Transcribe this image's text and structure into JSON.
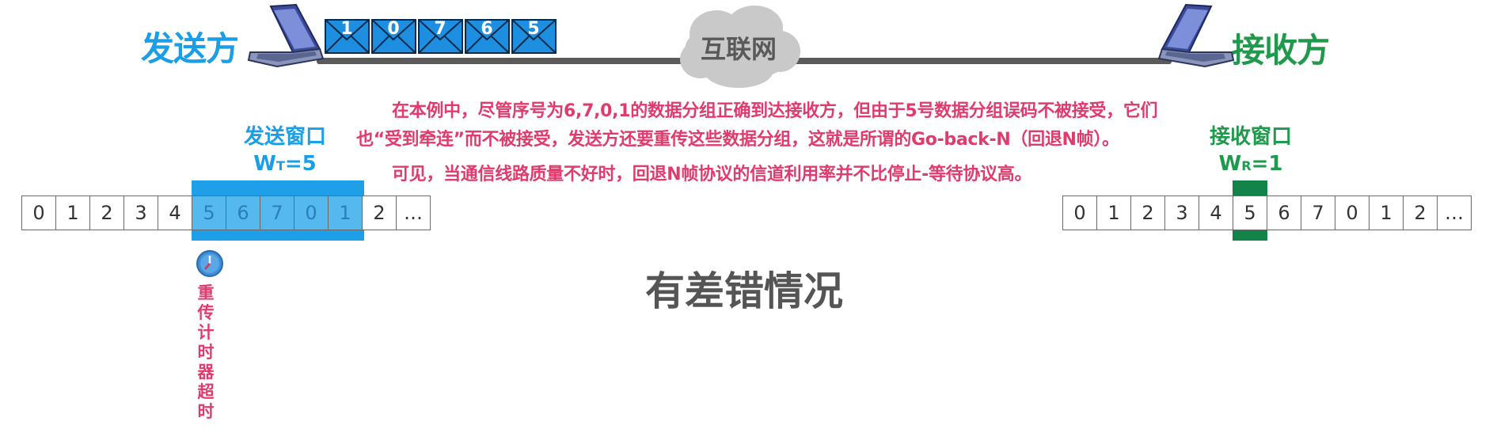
{
  "sender": {
    "label": "发送方"
  },
  "receiver": {
    "label": "接收方"
  },
  "network": {
    "label": "互联网"
  },
  "in_transit_frames": [
    "1",
    "0",
    "7",
    "6",
    "5"
  ],
  "explanation": {
    "line1": "在本例中，尽管序号为6,7,0,1的数据分组正确到达接收方，但由于5号数据分组误码不被接受，它们",
    "line2": "也“受到牵连”而不被接受，发送方还要重传这些数据分组，这就是所谓的Go-back-N（回退N帧）。",
    "line3": "可见，当通信线路质量不好时，回退N帧协议的信道利用率并不比停止-等待协议高。"
  },
  "send_window": {
    "title": "发送窗口",
    "size_prefix": "W",
    "size_sub": "T",
    "size_suffix": "=5"
  },
  "receive_window": {
    "title": "接收窗口",
    "size_prefix": "W",
    "size_sub": "R",
    "size_suffix": "=1"
  },
  "sender_sequence": [
    "0",
    "1",
    "2",
    "3",
    "4",
    "5",
    "6",
    "7",
    "0",
    "1",
    "2",
    "…"
  ],
  "receiver_sequence": [
    "0",
    "1",
    "2",
    "3",
    "4",
    "5",
    "6",
    "7",
    "0",
    "1",
    "2",
    "…"
  ],
  "timer": {
    "label": "重\n传\n计\n时\n器\n超\n时"
  },
  "case_title": "有差错情况",
  "colors": {
    "sender_blue": "#1a9ee5",
    "receiver_green": "#1f9a4c",
    "note_pink": "#e03b6d",
    "envelope_blue": "#1e8fe0"
  }
}
